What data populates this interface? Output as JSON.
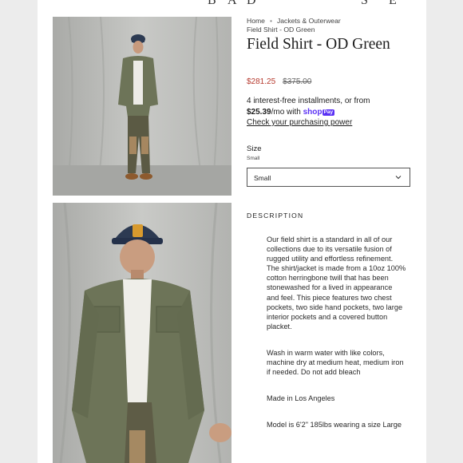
{
  "breadcrumb": {
    "home": "Home",
    "category": "Jackets & Outerwear",
    "current": "Field Shirt - OD Green",
    "separator": "•"
  },
  "product": {
    "title": "Field Shirt - OD Green",
    "sale_price": "$281.25",
    "compare_price": "$375.00"
  },
  "shop_pay": {
    "line1": "4 interest-free installments, or from",
    "amount": "$25.39",
    "per_month": "/mo with",
    "shop_word": "shop",
    "pay_word": "Pay",
    "link": "Check your purchasing power"
  },
  "size": {
    "label": "Size",
    "selected_text": "Small",
    "options_selected": "Small"
  },
  "description": {
    "heading": "DESCRIPTION",
    "paragraphs": [
      "Our field shirt is a standard in all of our collections due to its versatile fusion of rugged utility and effortless refinement. The shirt/jacket is made from a 10oz 100% cotton herringbone twill that has been stonewashed for a lived in appearance and feel. This piece features two chest pockets, two side hand pockets, two large interior pockets and a covered button placket.",
      "Wash in warm water with like colors, machine dry at medium heat, medium iron if needed. Do not add bleach",
      "Made in Los Angeles",
      "Model is 6'2\" 185lbs wearing a size Large"
    ]
  },
  "icons": {
    "select_chevron": "chevron-down-icon"
  },
  "colors": {
    "sale": "#b63a2e",
    "shop_pay": "#5a31f4",
    "jacket": "#6d7458",
    "background": "#ececec"
  }
}
